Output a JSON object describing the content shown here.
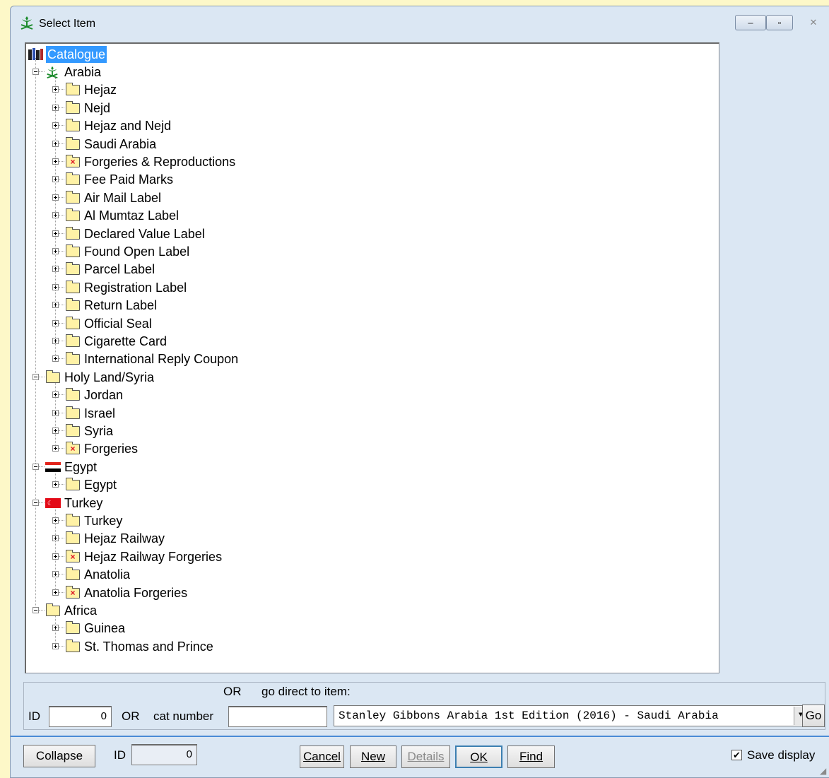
{
  "window": {
    "title": "Select Item",
    "controls": {
      "minimize": "‒",
      "maximize": "▫",
      "close": "✕"
    }
  },
  "tree": {
    "root": "Catalogue",
    "nodes": [
      {
        "label": "Arabia",
        "level": 1,
        "icon": "saudi-emblem-icon",
        "expanded": true
      },
      {
        "label": "Hejaz",
        "level": 2,
        "icon": "folder-icon"
      },
      {
        "label": "Nejd",
        "level": 2,
        "icon": "folder-icon"
      },
      {
        "label": "Hejaz and Nejd",
        "level": 2,
        "icon": "folder-icon"
      },
      {
        "label": "Saudi Arabia",
        "level": 2,
        "icon": "folder-icon"
      },
      {
        "label": "Forgeries & Reproductions",
        "level": 2,
        "icon": "forgery-folder-icon"
      },
      {
        "label": "Fee Paid Marks",
        "level": 2,
        "icon": "folder-icon"
      },
      {
        "label": "Air Mail Label",
        "level": 2,
        "icon": "folder-icon"
      },
      {
        "label": "Al Mumtaz Label",
        "level": 2,
        "icon": "folder-icon"
      },
      {
        "label": "Declared Value Label",
        "level": 2,
        "icon": "folder-icon"
      },
      {
        "label": "Found Open Label",
        "level": 2,
        "icon": "folder-icon"
      },
      {
        "label": "Parcel Label",
        "level": 2,
        "icon": "folder-icon"
      },
      {
        "label": "Registration Label",
        "level": 2,
        "icon": "folder-icon"
      },
      {
        "label": "Return Label",
        "level": 2,
        "icon": "folder-icon"
      },
      {
        "label": "Official Seal",
        "level": 2,
        "icon": "folder-icon"
      },
      {
        "label": "Cigarette Card",
        "level": 2,
        "icon": "folder-icon"
      },
      {
        "label": "International Reply Coupon",
        "level": 2,
        "icon": "folder-icon"
      },
      {
        "label": "Holy Land/Syria",
        "level": 1,
        "icon": "folder-icon",
        "expanded": true
      },
      {
        "label": "Jordan",
        "level": 2,
        "icon": "folder-icon"
      },
      {
        "label": "Israel",
        "level": 2,
        "icon": "folder-icon"
      },
      {
        "label": "Syria",
        "level": 2,
        "icon": "folder-icon"
      },
      {
        "label": "Forgeries",
        "level": 2,
        "icon": "forgery-folder-icon"
      },
      {
        "label": "Egypt",
        "level": 1,
        "icon": "egypt-flag-icon",
        "expanded": true
      },
      {
        "label": "Egypt",
        "level": 2,
        "icon": "folder-icon"
      },
      {
        "label": "Turkey",
        "level": 1,
        "icon": "turkey-flag-icon",
        "expanded": true
      },
      {
        "label": "Turkey",
        "level": 2,
        "icon": "folder-icon"
      },
      {
        "label": "Hejaz Railway",
        "level": 2,
        "icon": "folder-icon"
      },
      {
        "label": "Hejaz Railway Forgeries",
        "level": 2,
        "icon": "forgery-folder-icon"
      },
      {
        "label": "Anatolia",
        "level": 2,
        "icon": "folder-icon"
      },
      {
        "label": "Anatolia Forgeries",
        "level": 2,
        "icon": "forgery-folder-icon"
      },
      {
        "label": "Africa",
        "level": 1,
        "icon": "folder-icon",
        "expanded": true
      },
      {
        "label": "Guinea",
        "level": 2,
        "icon": "folder-icon"
      },
      {
        "label": "St. Thomas and Prince",
        "level": 2,
        "icon": "folder-icon"
      }
    ]
  },
  "direct": {
    "or_label": "OR",
    "go_direct_label": "go direct to item:",
    "id_label": "ID",
    "id_value": "0",
    "or2_label": "OR",
    "cat_number_label": "cat number",
    "cat_number_value": "",
    "catalogue_selected": "Stanley Gibbons Arabia 1st Edition (2016) - Saudi Arabia",
    "go_label": "Go"
  },
  "footer": {
    "collapse_label": "Collapse",
    "id_label": "ID",
    "id_value": "0",
    "cancel_label": "Cancel",
    "new_label": "New",
    "details_label": "Details",
    "ok_label": "OK",
    "find_label": "Find",
    "save_display_label": "Save display",
    "save_display_checked": true
  }
}
